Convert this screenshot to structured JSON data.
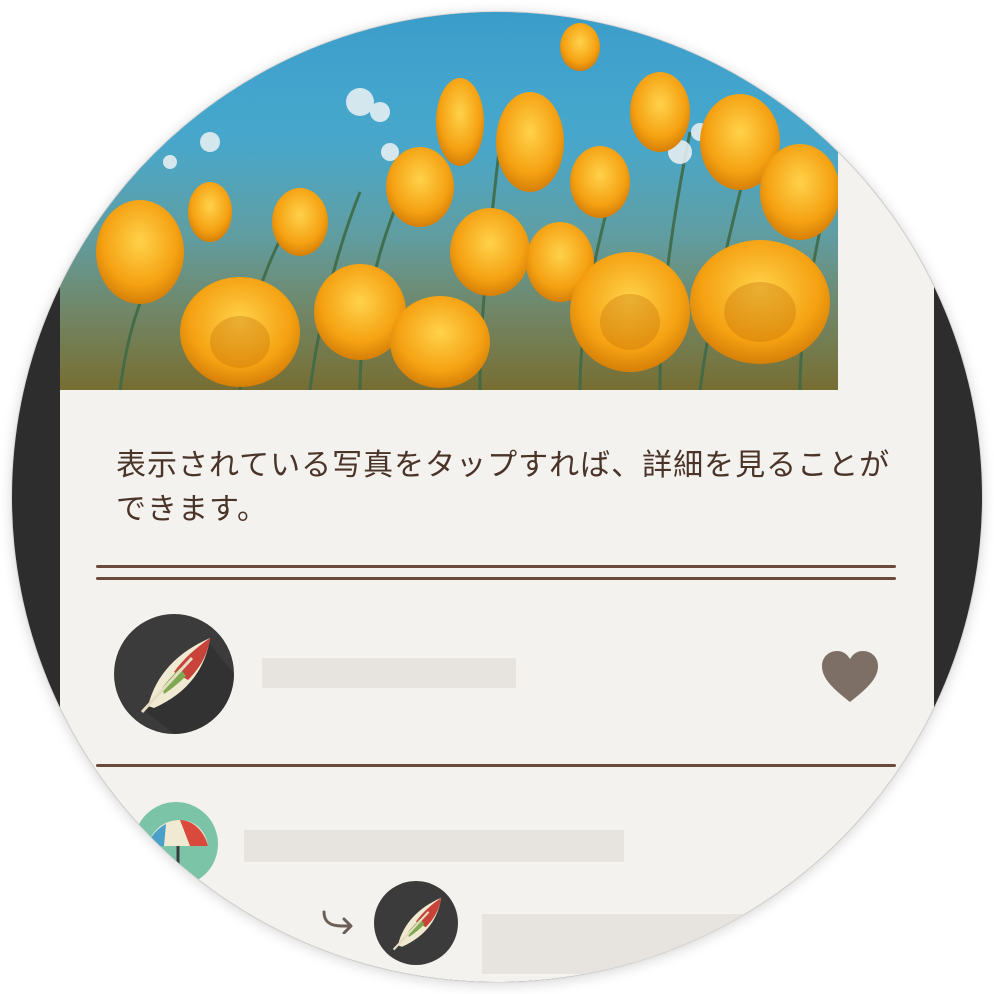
{
  "post": {
    "description": "表示されている写真をタップすれば、詳細を見ることができます。"
  },
  "icons": {
    "photo": "poppy-field-photo",
    "author_avatar": "feather-avatar-icon",
    "like": "heart-icon",
    "commenter_avatar": "umbrella-avatar-icon",
    "reply": "reply-arrow-icon",
    "reply_avatar": "feather-avatar-icon"
  },
  "colors": {
    "paper": "#f4f2ee",
    "frame": "#2d2d2d",
    "text": "#4a3328",
    "rule": "#6b4a3a",
    "heart": "#7d6f65",
    "placeholder": "#e7e4df"
  }
}
